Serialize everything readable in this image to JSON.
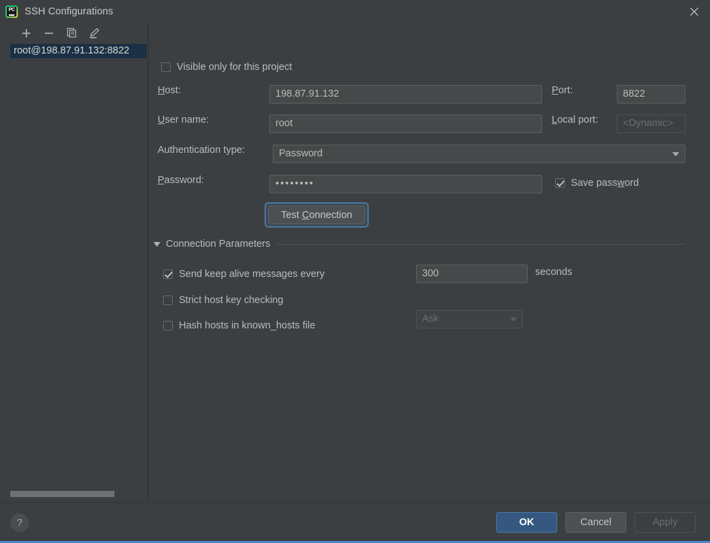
{
  "window": {
    "title": "SSH Configurations",
    "app_icon": "pycharm-icon",
    "close_icon": "close-icon"
  },
  "sidebar": {
    "toolbar": [
      {
        "name": "add-button",
        "icon": "plus-icon",
        "tooltip": "Add"
      },
      {
        "name": "remove-button",
        "icon": "minus-icon",
        "tooltip": "Remove"
      },
      {
        "name": "copy-button",
        "icon": "copy-icon",
        "tooltip": "Copy"
      },
      {
        "name": "edit-button",
        "icon": "pencil-icon",
        "tooltip": "Edit"
      }
    ],
    "items": [
      {
        "label": "root@198.87.91.132:8822",
        "selected": true
      }
    ]
  },
  "form": {
    "visible_only_checkbox": {
      "label": "Visible only for this project",
      "checked": false
    },
    "host": {
      "label_prefix": "",
      "label_mnemonic": "H",
      "label_rest": "ost:",
      "value": "198.87.91.132"
    },
    "port": {
      "label_mnemonic": "P",
      "label_rest": "ort:",
      "value": "8822"
    },
    "user_name": {
      "label_mnemonic": "U",
      "label_rest": "ser name:",
      "value": "root"
    },
    "local_port": {
      "label_mnemonic": "L",
      "label_rest": "ocal port:",
      "value": "<Dynamic>",
      "disabled": true
    },
    "auth_type": {
      "label": "Authentication type:",
      "value": "Password"
    },
    "password": {
      "label_mnemonic": "P",
      "label_rest": "assword:",
      "value": "••••••••"
    },
    "save_password": {
      "label_prefix": "Save pass",
      "label_mnemonic": "w",
      "label_rest": "ord",
      "checked": true
    },
    "test_connection": {
      "label_prefix": "Test ",
      "label_mnemonic": "C",
      "label_rest": "onnection",
      "focused": true
    }
  },
  "connection_parameters": {
    "section_title": "Connection Parameters",
    "expanded": true,
    "keep_alive": {
      "label": "Send keep alive messages every",
      "checked": true,
      "value": "300",
      "unit": "seconds"
    },
    "strict_host_key": {
      "label": "Strict host key checking",
      "checked": false,
      "dropdown_value": "Ask",
      "dropdown_disabled": true
    },
    "hash_hosts": {
      "label": "Hash hosts in known_hosts file",
      "checked": false
    }
  },
  "footer": {
    "help_label": "?",
    "ok_label": "OK",
    "cancel_label": "Cancel",
    "apply_label": "Apply",
    "apply_disabled": true
  },
  "colors": {
    "background": "#3c3f41",
    "field_background": "#45494a",
    "selection": "#1b3044",
    "primary_button": "#365880",
    "focus_ring": "#4a7aa8",
    "accent_line": "#4a88c7",
    "text": "#bbbbbb"
  }
}
